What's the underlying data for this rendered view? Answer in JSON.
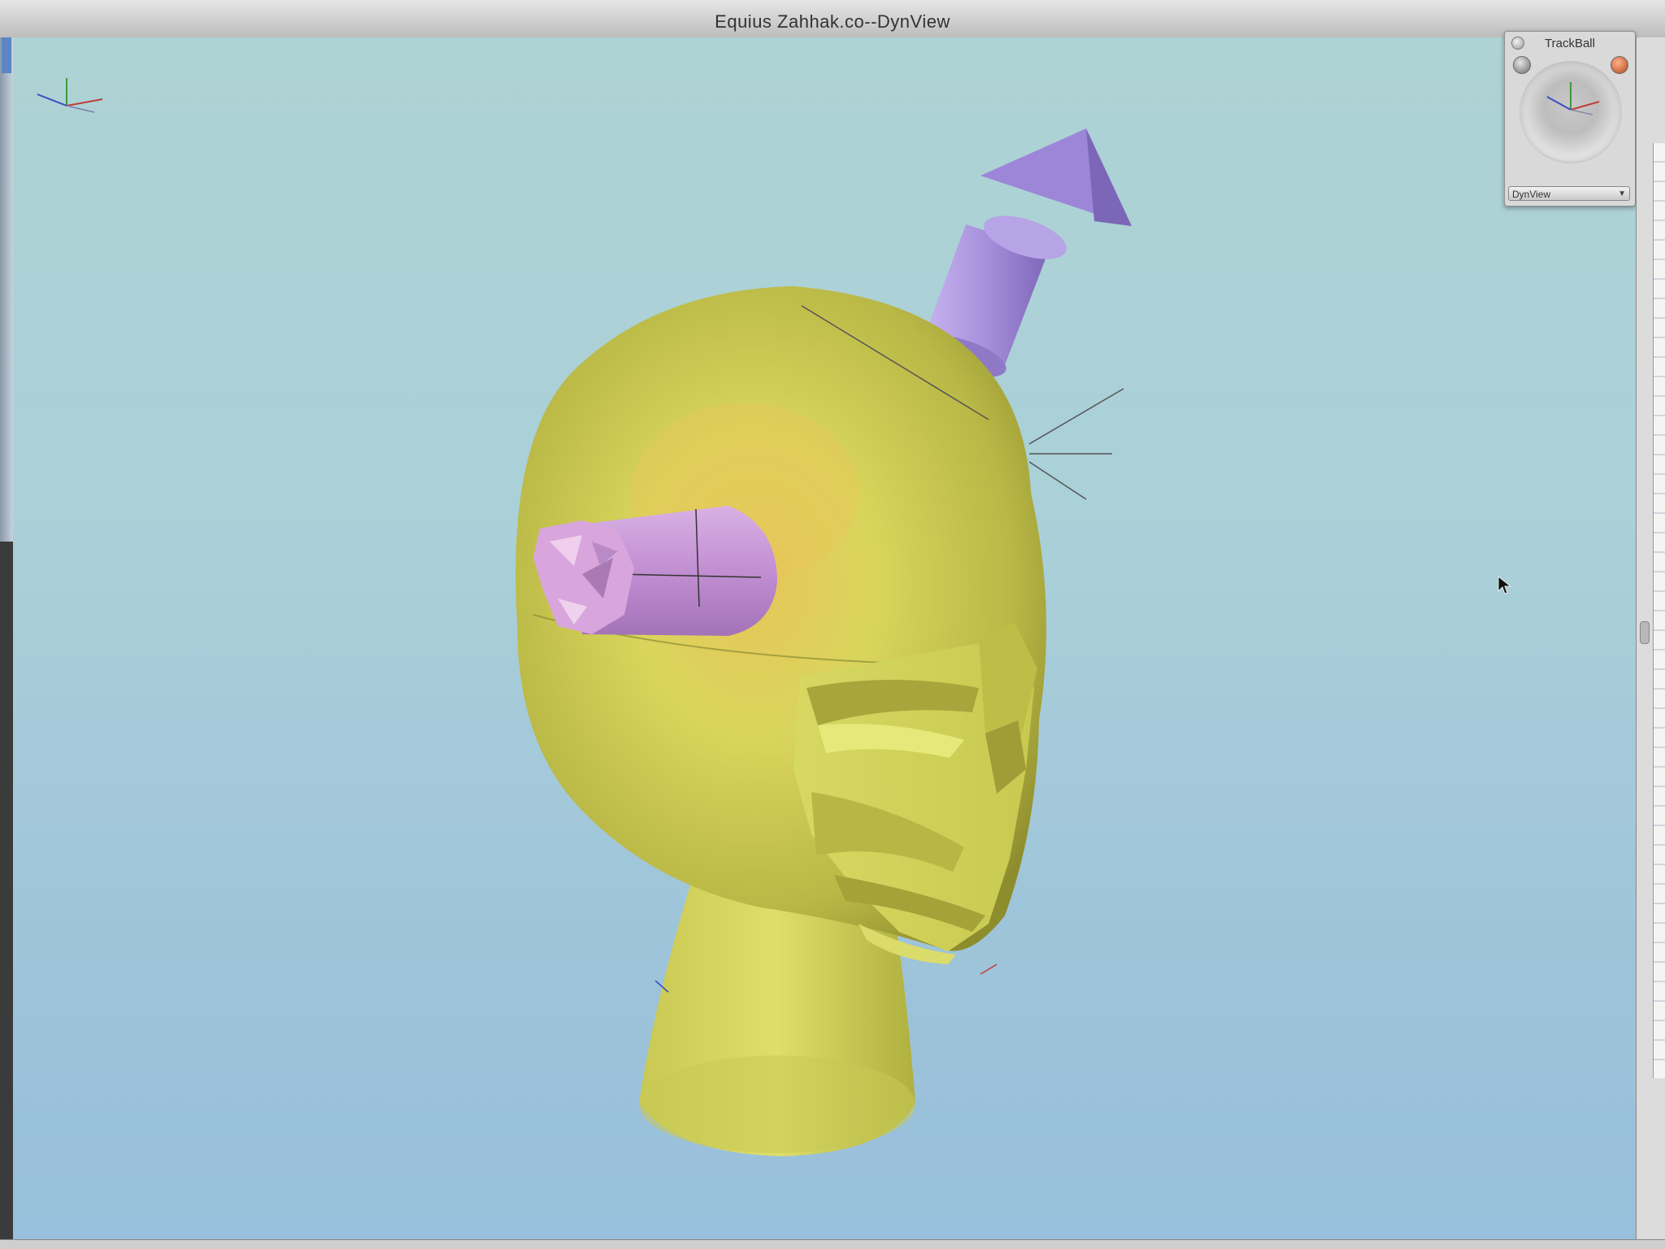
{
  "window": {
    "title": "Equius Zahhak.co--DynView"
  },
  "viewport": {
    "content": "3d-head-model",
    "background_top": "#aed3d4",
    "background_bottom": "#98bfdb",
    "model_color": "#d6d564",
    "arrow_color": "#a48fd6",
    "horn_color": "#c79ad8"
  },
  "trackball": {
    "title": "TrackBall",
    "view_select": "DynView",
    "close_icon": "close-icon",
    "left_button_icon": "gray-circle-icon",
    "right_button_icon": "red-circle-icon"
  },
  "icons": {
    "axis_triad": "axis-triad-icon",
    "cursor": "arrow-cursor-icon"
  }
}
